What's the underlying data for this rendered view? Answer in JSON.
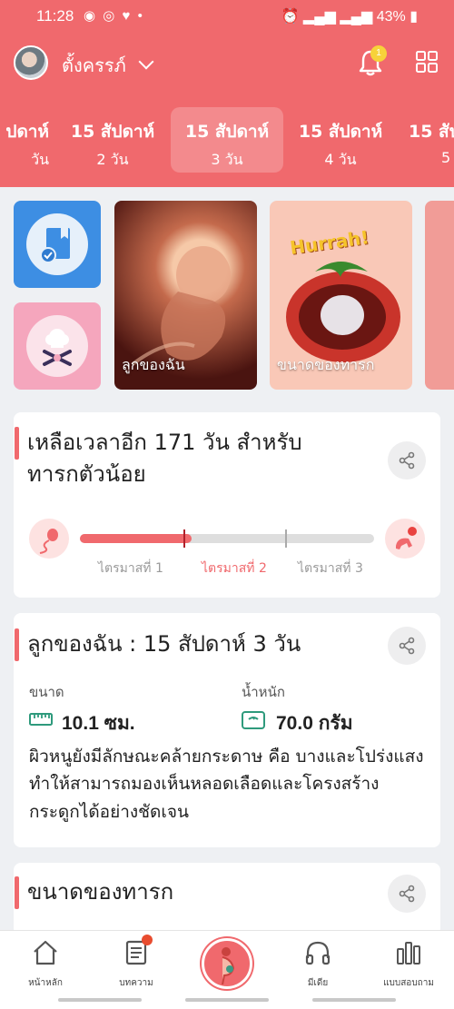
{
  "status_bar": {
    "time": "11:28",
    "battery": "43%"
  },
  "header": {
    "username": "ตั้งครรภ์",
    "notification_count": "1"
  },
  "weeks": [
    {
      "week": "ปดาห์",
      "day": "วัน"
    },
    {
      "week": "15 สัปดาห์",
      "day": "2 วัน"
    },
    {
      "week": "15 สัปดาห์",
      "day": "3 วัน"
    },
    {
      "week": "15 สัปดาห์",
      "day": "4 วัน"
    },
    {
      "week": "15 สัป",
      "day": "5"
    }
  ],
  "feature_cards": [
    {
      "caption": "ลูกของฉัน"
    },
    {
      "caption": "ขนาดของทารก",
      "badge_text": "Hurrah!"
    }
  ],
  "countdown_card": {
    "title_line1": "เหลือเวลาอีก 171 วัน สำหรับ",
    "title_line2": "ทารกตัวน้อย",
    "progress": 0.38,
    "trimesters": [
      "ไตรมาสที่ 1",
      "ไตรมาสที่ 2",
      "ไตรมาสที่ 3"
    ],
    "active_trimester": 1
  },
  "baby_card": {
    "title": "ลูกของฉัน : 15 สัปดาห์ 3  วัน",
    "size_label": "ขนาด",
    "size_value": "10.1 ซม.",
    "weight_label": "น้ำหนัก",
    "weight_value": "70.0 กรัม",
    "description": "ผิวหนูยังมีลักษณะคล้ายกระดาษ คือ บางและโปร่งแสง ทำให้สามารถมองเห็นหลอดเลือดและโครงสร้างกระดูกได้อย่างชัดเจน"
  },
  "size_card": {
    "title": "ขนาดของทารก"
  },
  "bottom_nav": [
    {
      "label": "หน้าหลัก",
      "icon": "home-icon"
    },
    {
      "label": "บทความ",
      "icon": "article-icon"
    },
    {
      "label": "",
      "icon": "pregnancy-icon"
    },
    {
      "label": "มีเดีย",
      "icon": "headphones-icon"
    },
    {
      "label": "แบบสอบถาม",
      "icon": "chart-icon"
    }
  ],
  "colors": {
    "primary": "#f0696d",
    "background": "#eef0f3",
    "blue_tile": "#3d8ee3",
    "pink_tile": "#f5a6bd"
  }
}
